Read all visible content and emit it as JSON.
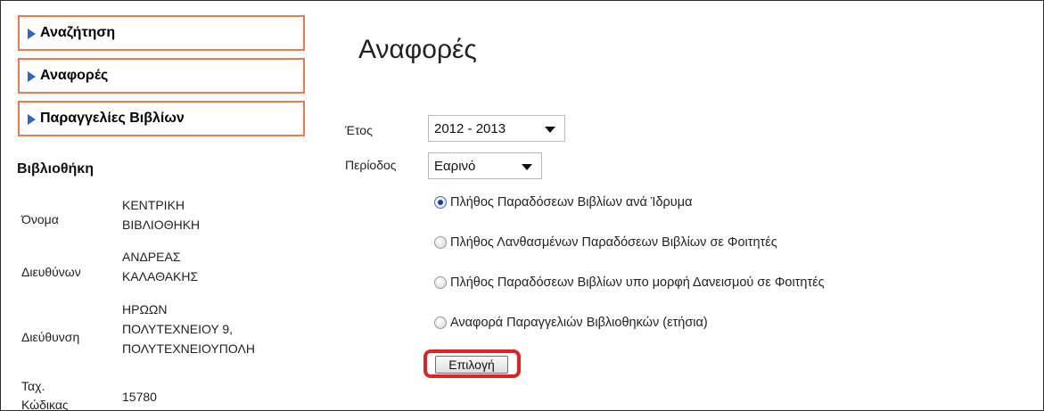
{
  "sidebar": {
    "nav": [
      {
        "label": "Αναζήτηση"
      },
      {
        "label": "Αναφορές"
      },
      {
        "label": "Παραγγελίες Βιβλίων"
      }
    ],
    "library": {
      "title": "Βιβλιοθήκη",
      "fields": [
        {
          "label": "Όνομα",
          "value": [
            "ΚΕΝΤΡΙΚΗ",
            "ΒΙΒΛΙΟΘΗΚΗ"
          ]
        },
        {
          "label": "Διευθύνων",
          "value": [
            "ΑΝΔΡΕΑΣ",
            "ΚΑΛΑΘΑΚΗΣ"
          ]
        },
        {
          "label": "Διεύθυνση",
          "value": [
            "ΗΡΩΩΝ",
            "ΠΟΛΥΤΕΧΝΕΙΟΥ 9,",
            "ΠΟΛΥΤΕΧΝΕΙΟΥΠΟΛΗ"
          ]
        },
        {
          "label": [
            "Ταχ.",
            "Κώδικας"
          ],
          "value": [
            "15780"
          ]
        }
      ]
    }
  },
  "main": {
    "title": "Αναφορές",
    "year": {
      "label": "Έτος",
      "selected": "2012 - 2013"
    },
    "period": {
      "label": "Περίοδος",
      "selected": "Εαρινό"
    },
    "reports": [
      {
        "label": "Πλήθος Παραδόσεων Βιβλίων ανά Ίδρυμα",
        "checked": true
      },
      {
        "label": "Πλήθος Λανθασμένων Παραδόσεων Βιβλίων σε Φοιτητές",
        "checked": false
      },
      {
        "label": "Πλήθος Παραδόσεων Βιβλίων υπο μορφή Δανεισμού σε Φοιτητές",
        "checked": false
      },
      {
        "label": "Αναφορά Παραγγελιών Βιβλιοθηκών (ετήσια)",
        "checked": false
      }
    ],
    "submit_label": "Επιλογή"
  },
  "colors": {
    "nav_border": "#f07a4a",
    "nav_arrow": "#2b66c4",
    "highlight": "#e02222"
  }
}
